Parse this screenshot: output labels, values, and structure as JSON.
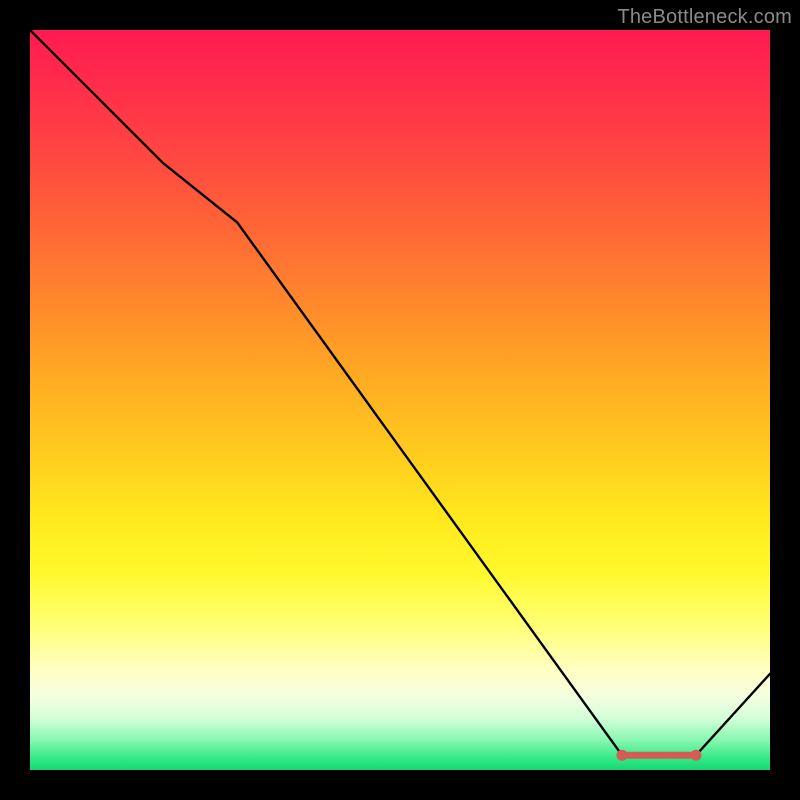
{
  "watermark": "TheBottleneck.com",
  "chart_data": {
    "type": "line",
    "title": "",
    "xlabel": "",
    "ylabel": "",
    "x": [
      0.0,
      0.08,
      0.18,
      0.28,
      0.8,
      0.9,
      1.0
    ],
    "series": [
      {
        "name": "curve",
        "color": "#000000",
        "values": [
          1.0,
          0.92,
          0.82,
          0.74,
          0.02,
          0.02,
          0.13
        ]
      }
    ],
    "flat_marker": {
      "name": "bottleneck-zone",
      "color": "#d15d56",
      "x_start": 0.8,
      "x_end": 0.9,
      "y": 0.02
    },
    "xlim": [
      0,
      1
    ],
    "ylim": [
      0,
      1
    ],
    "grid": false,
    "legend": false
  },
  "colors": {
    "black": "#000000",
    "marker": "#d15d56",
    "watermark": "#8a8a8a"
  }
}
